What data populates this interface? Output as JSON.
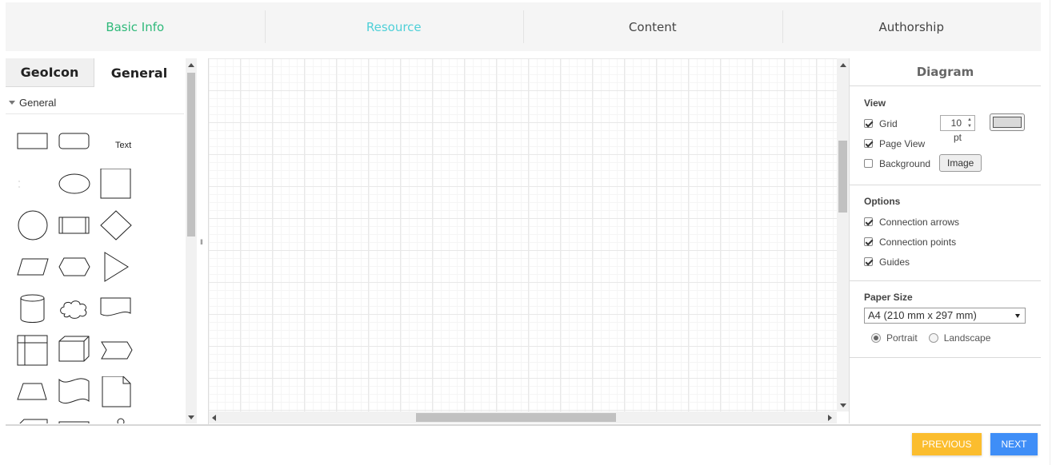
{
  "steps": {
    "items": [
      {
        "label": "Basic Info",
        "state": "done"
      },
      {
        "label": "Resource",
        "state": "active"
      },
      {
        "label": "Content",
        "state": "pending"
      },
      {
        "label": "Authorship",
        "state": "pending"
      }
    ]
  },
  "sidebar": {
    "tabs": [
      "GeoIcon",
      "General"
    ],
    "active_tab": "General",
    "section_label": "General",
    "text_shape_label": "Text"
  },
  "format_panel": {
    "title": "Diagram",
    "view": {
      "heading": "View",
      "grid_label": "Grid",
      "grid_checked": true,
      "grid_size": "10 pt",
      "page_view_label": "Page View",
      "page_view_checked": true,
      "background_label": "Background",
      "background_checked": false,
      "image_button": "Image"
    },
    "options": {
      "heading": "Options",
      "connection_arrows": "Connection arrows",
      "connection_points": "Connection points",
      "guides": "Guides"
    },
    "paper": {
      "heading": "Paper Size",
      "selected": "A4 (210 mm x 297 mm)",
      "portrait": "Portrait",
      "landscape": "Landscape",
      "orientation": "Portrait"
    }
  },
  "footer": {
    "previous": "PREVIOUS",
    "next": "NEXT"
  },
  "colors": {
    "step_done": "#2fb97a",
    "step_active": "#4fd0d8",
    "previous_button": "#fbbd2e",
    "next_button": "#3f8ef7"
  }
}
